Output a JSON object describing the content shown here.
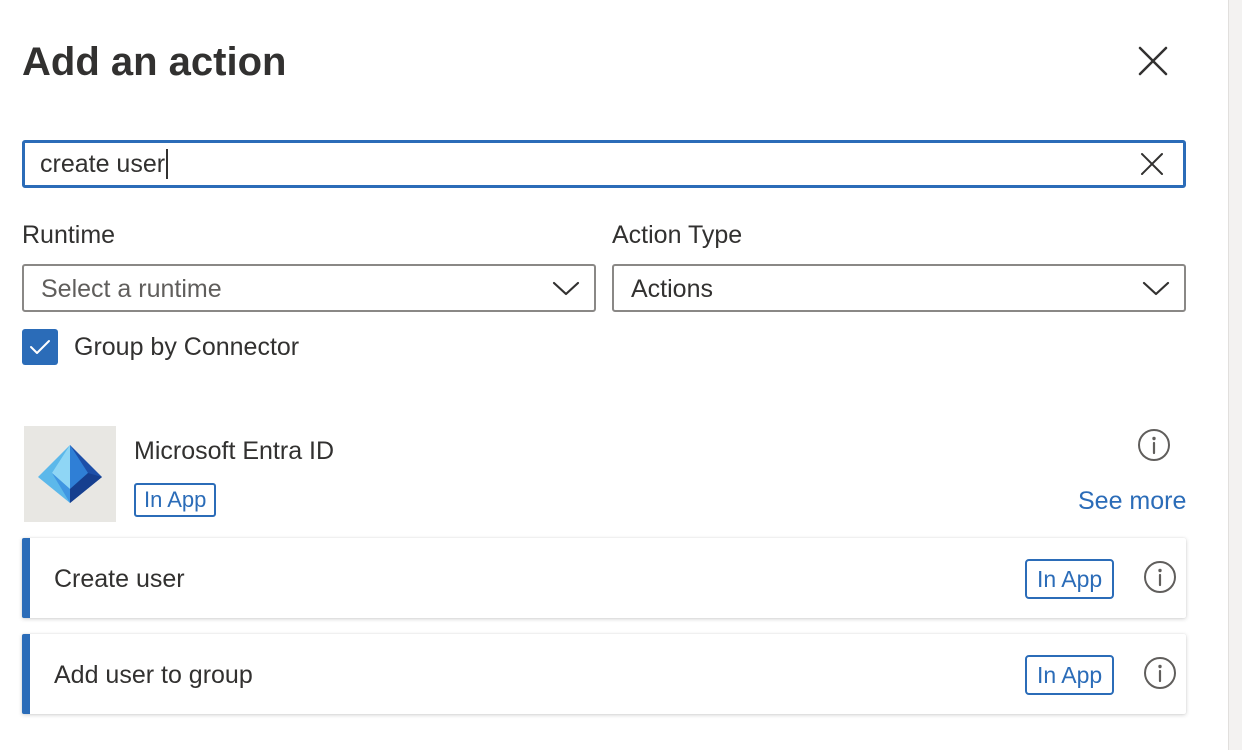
{
  "panel": {
    "title": "Add an action",
    "close_icon": "close-icon"
  },
  "search": {
    "value": "create user",
    "clear_icon": "close-icon"
  },
  "filters": {
    "runtime": {
      "label": "Runtime",
      "placeholder": "Select a runtime",
      "icon": "chevron-down-icon"
    },
    "action_type": {
      "label": "Action Type",
      "value": "Actions",
      "icon": "chevron-down-icon"
    }
  },
  "group_by_connector": {
    "label": "Group by Connector",
    "checked": true
  },
  "connector": {
    "name": "Microsoft Entra ID",
    "badge": "In App",
    "see_more": "See more",
    "logo_icon": "entra-id-logo-icon",
    "info_icon": "info-icon"
  },
  "actions": [
    {
      "label": "Create user",
      "badge": "In App",
      "info_icon": "info-icon"
    },
    {
      "label": "Add user to group",
      "badge": "In App",
      "info_icon": "info-icon"
    }
  ],
  "colors": {
    "accent": "#2b6cb8",
    "text": "#323130",
    "placeholder": "#605e5c",
    "border": "#8a8886",
    "logo_background": "#e8e7e3"
  }
}
